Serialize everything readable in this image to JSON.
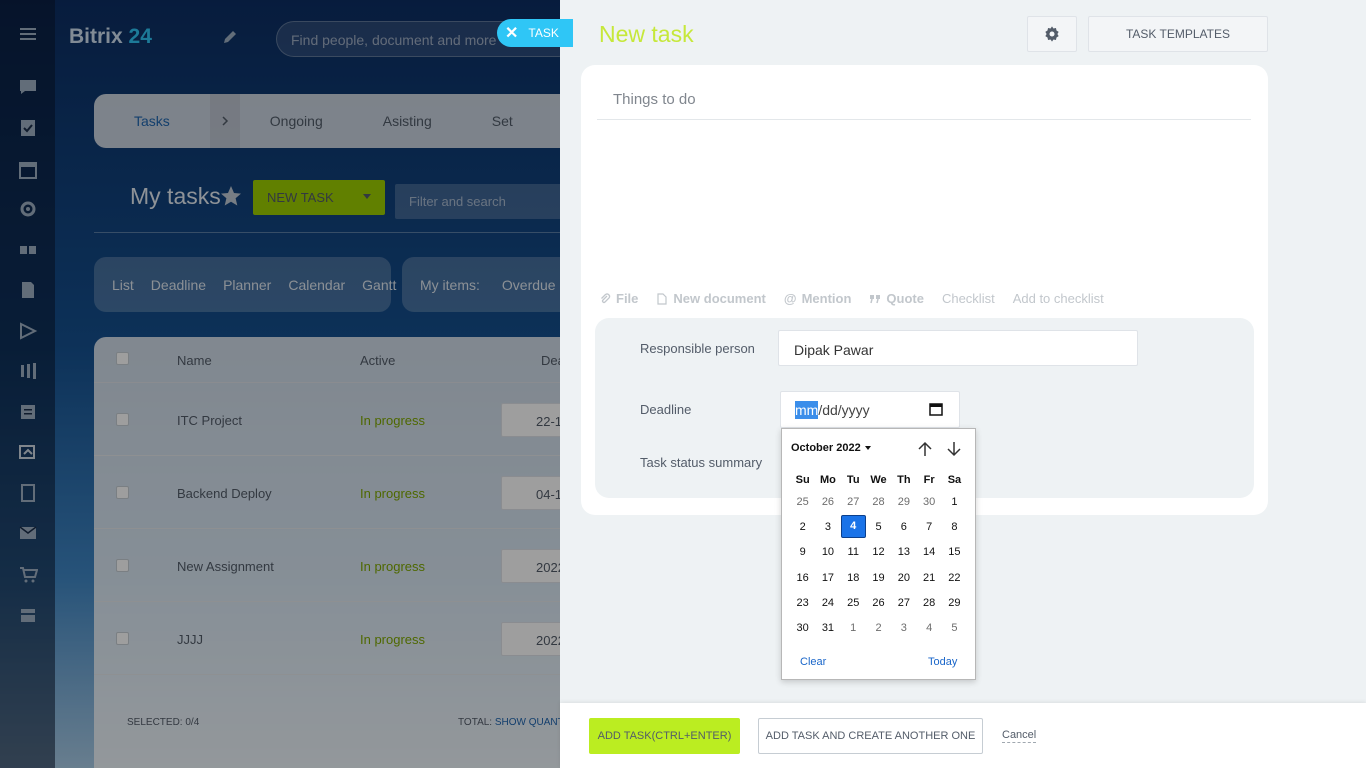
{
  "background": {
    "brand_name": "Bitrix",
    "brand_num": "24",
    "search_placeholder": "Find people, document and more",
    "task_chip": "TASK",
    "tabs": [
      "Tasks",
      "Ongoing",
      "Asisting",
      "Set"
    ],
    "my_tasks": "My tasks",
    "new_task_button": "NEW TASK",
    "filter_placeholder": "Filter and search",
    "views": [
      "List",
      "Deadline",
      "Planner",
      "Calendar",
      "Gantt"
    ],
    "my_items_label": "My items:",
    "my_items_overdue": "Overdue",
    "grid": {
      "col_name": "Name",
      "col_active": "Active",
      "col_deadline": "Dea",
      "rows": [
        {
          "name": "ITC Project",
          "status": "In progress",
          "deadline": "22-1"
        },
        {
          "name": "Backend Deploy",
          "status": "In progress",
          "deadline": "04-1"
        },
        {
          "name": "New Assignment",
          "status": "In progress",
          "deadline": "2022"
        },
        {
          "name": "JJJJ",
          "status": "In progress",
          "deadline": "2022"
        }
      ],
      "selected": "SELECTED: 0/4",
      "total_label": "TOTAL:",
      "show_quantity": "SHOW QUANT"
    }
  },
  "panel": {
    "title": "New task",
    "templates_button": "TASK TEMPLATES",
    "title_placeholder": "Things to do",
    "toolbar": {
      "file": "File",
      "new_document": "New document",
      "mention": "Mention",
      "quote": "Quote",
      "checklist": "Checklist",
      "add_to_checklist": "Add to checklist"
    },
    "responsible_label": "Responsible person",
    "responsible_value": "Dipak Pawar",
    "deadline_label": "Deadline",
    "deadline_mm": "mm",
    "deadline_rest": "/dd/yyyy",
    "status_summary_label": "Task status summary"
  },
  "datepicker": {
    "month_year": "October 2022",
    "weekdays": [
      "Su",
      "Mo",
      "Tu",
      "We",
      "Th",
      "Fr",
      "Sa"
    ],
    "weeks": [
      [
        "25",
        "26",
        "27",
        "28",
        "29",
        "30",
        "1"
      ],
      [
        "2",
        "3",
        "4",
        "5",
        "6",
        "7",
        "8"
      ],
      [
        "9",
        "10",
        "11",
        "12",
        "13",
        "14",
        "15"
      ],
      [
        "16",
        "17",
        "18",
        "19",
        "20",
        "21",
        "22"
      ],
      [
        "23",
        "24",
        "25",
        "26",
        "27",
        "28",
        "29"
      ],
      [
        "30",
        "31",
        "1",
        "2",
        "3",
        "4",
        "5"
      ]
    ],
    "selected_day": "4",
    "clear": "Clear",
    "today": "Today"
  },
  "footer": {
    "add_task": "ADD TASK(CTRL+ENTER)",
    "add_another": "ADD TASK AND CREATE ANOTHER ONE",
    "cancel": "Cancel"
  },
  "colors": {
    "accent_green": "#bbed21",
    "title_green": "#c6e83a",
    "selected_day": "#1a73e8",
    "chip_blue": "#2fc6f6"
  }
}
